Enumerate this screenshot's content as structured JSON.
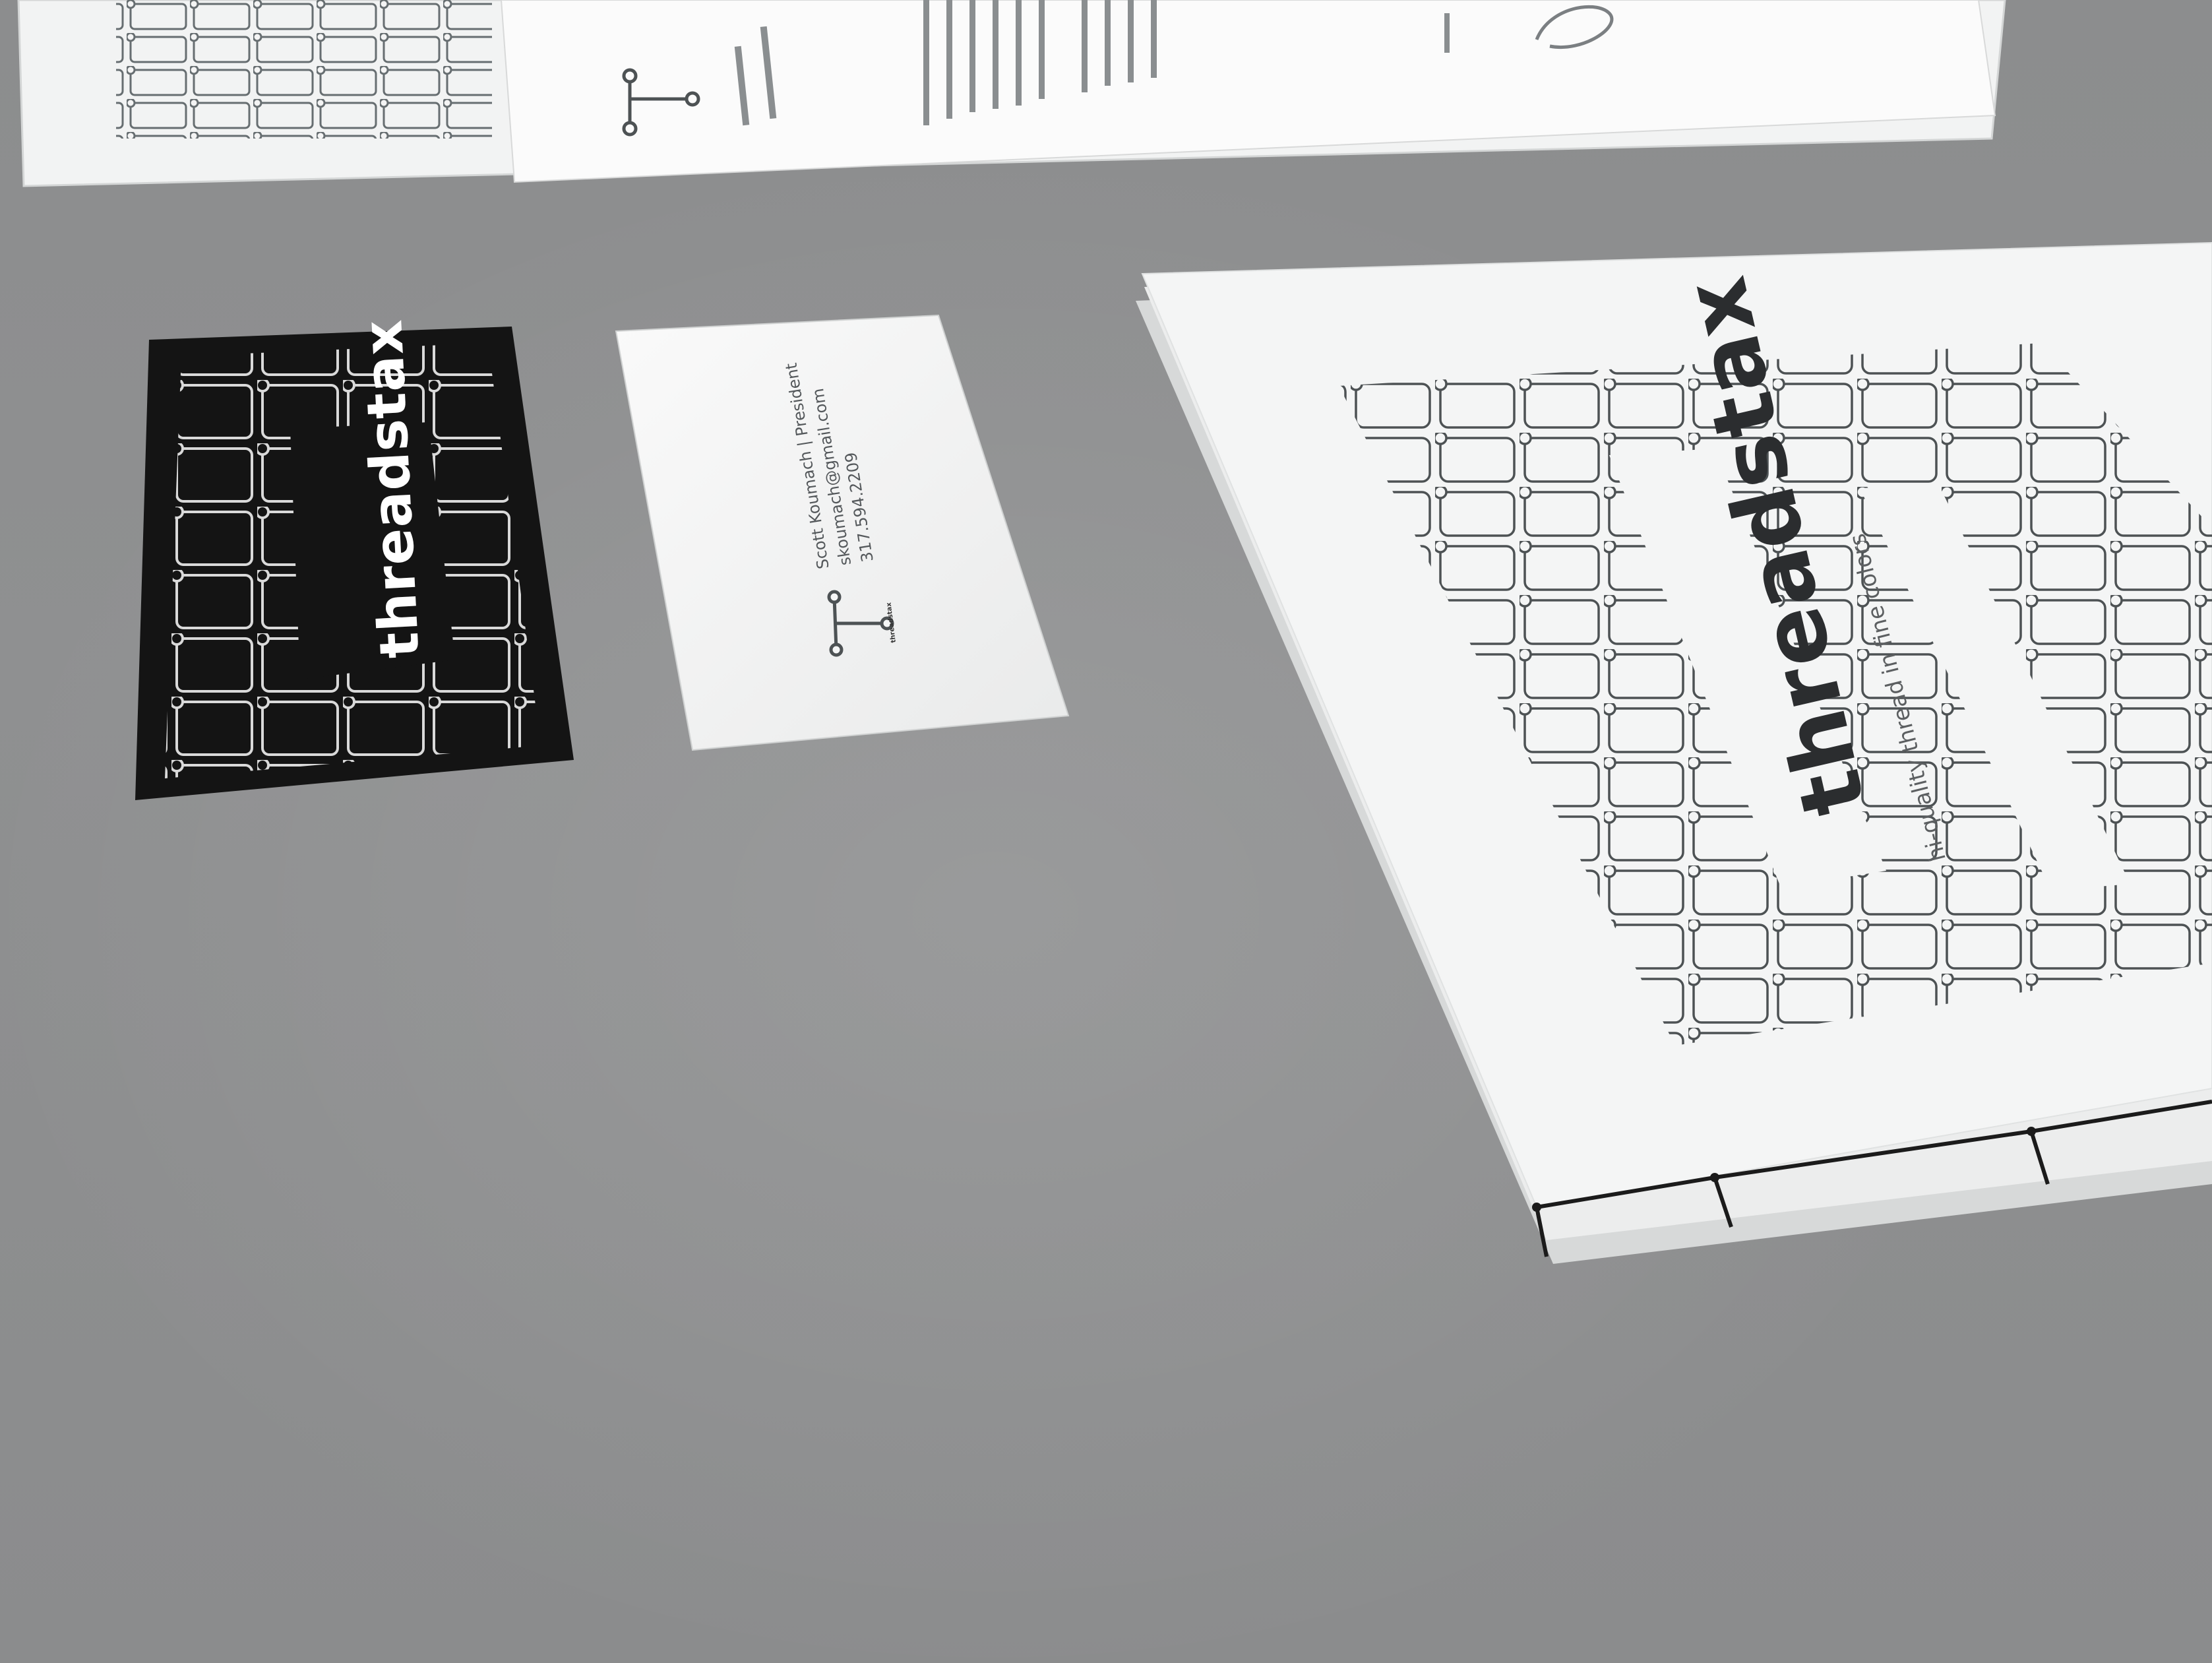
{
  "scene": {
    "description_colors": {
      "table": "#8f9091",
      "paper": "#f4f5f5",
      "dark_card": "#141414",
      "grid_line": "#4d5254",
      "thread": "#1b1b1b"
    }
  },
  "business_card_dark": {
    "brand": "threadstax"
  },
  "business_card_light": {
    "name_title": "Scott Koumach | President",
    "email": "skoumach@gmail.com",
    "phone": "317.594.2209",
    "brand_small": "threadstax"
  },
  "booklet_cover": {
    "brand": "threadstax",
    "tagline": "hi-quality thread in fine colors"
  }
}
